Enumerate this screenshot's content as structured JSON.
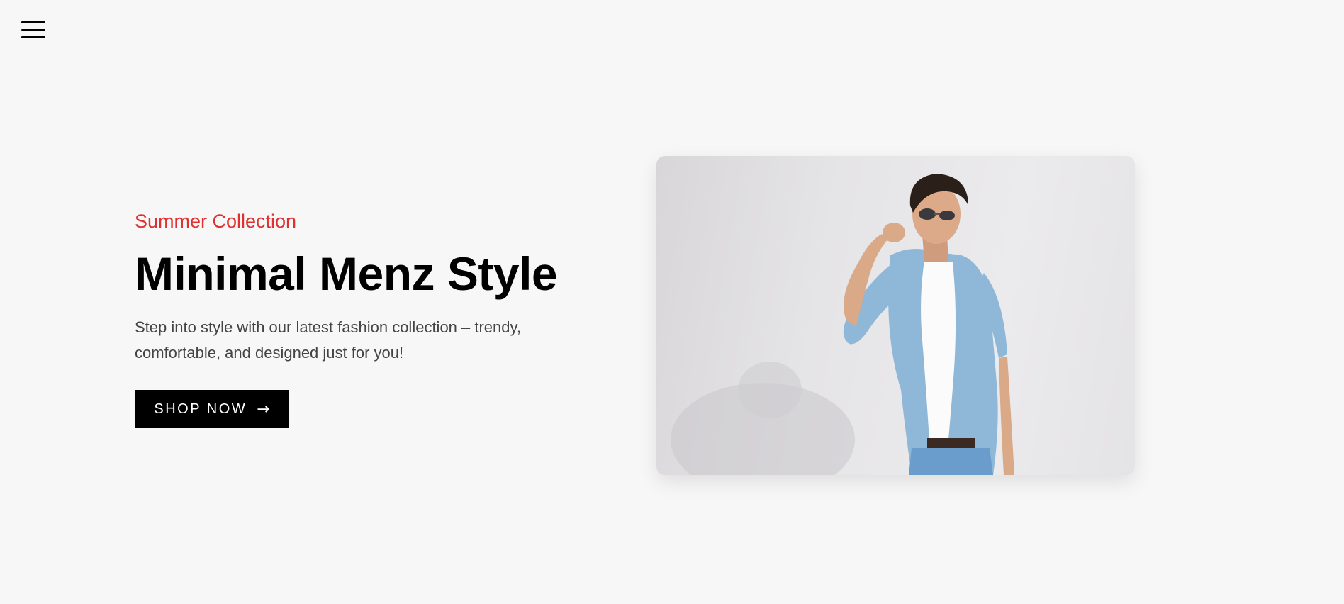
{
  "nav": {
    "menu_icon": "hamburger-menu-icon"
  },
  "hero": {
    "subtitle": "Summer Collection",
    "title": "Minimal Menz Style",
    "description": "Step into style with our latest fashion collection – trendy, comfortable, and designed just for you!",
    "cta_label": "SHOP NOW",
    "cta_icon": "arrow-right-icon",
    "cta_arrow": "→"
  },
  "colors": {
    "accent": "#e03131",
    "background": "#f7f7f7",
    "button": "#000000"
  }
}
